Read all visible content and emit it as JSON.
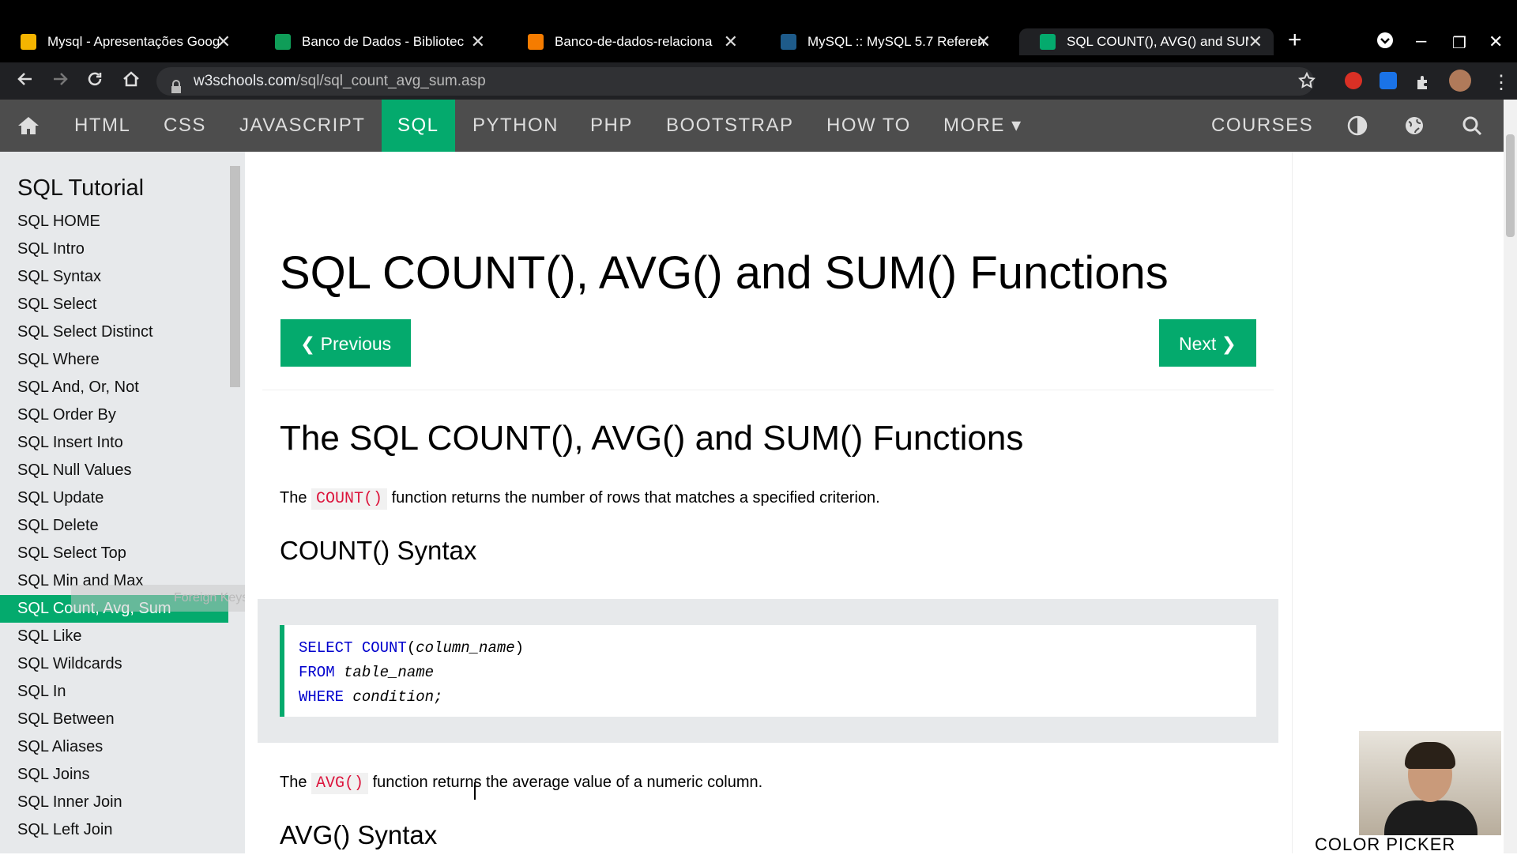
{
  "browser": {
    "tabs": [
      {
        "title": "Mysql - Apresentações Goog",
        "favicon_color": "#f4b400"
      },
      {
        "title": "Banco de Dados - Bibliotec",
        "favicon_color": "#0f9d58"
      },
      {
        "title": "Banco-de-dados-relaciona",
        "favicon_color": "#f57c00"
      },
      {
        "title": "MySQL :: MySQL 5.7 Referen",
        "favicon_color": "#1e5b8a"
      },
      {
        "title": "SQL COUNT(), AVG() and SUM",
        "favicon_color": "#04aa6d"
      }
    ],
    "url_domain": "w3schools.com",
    "url_path": "/sql/sql_count_avg_sum.asp",
    "new_tab_glyph": "+",
    "close_glyph": "✕"
  },
  "topnav": {
    "items": [
      "HTML",
      "CSS",
      "JAVASCRIPT",
      "SQL",
      "PYTHON",
      "PHP",
      "BOOTSTRAP",
      "HOW TO",
      "MORE ▾"
    ],
    "active": "SQL",
    "courses": "COURSES",
    "accent": "#04aa6d"
  },
  "sidebar": {
    "title": "SQL Tutorial",
    "items": [
      "SQL HOME",
      "SQL Intro",
      "SQL Syntax",
      "SQL Select",
      "SQL Select Distinct",
      "SQL Where",
      "SQL And, Or, Not",
      "SQL Order By",
      "SQL Insert Into",
      "SQL Null Values",
      "SQL Update",
      "SQL Delete",
      "SQL Select Top",
      "SQL Min and Max",
      "SQL Count, Avg, Sum",
      "SQL Like",
      "SQL Wildcards",
      "SQL In",
      "SQL Between",
      "SQL Aliases",
      "SQL Joins",
      "SQL Inner Join",
      "SQL Left Join"
    ],
    "active": "SQL Count, Avg, Sum",
    "drag_ghost": "Foreign Keys"
  },
  "main": {
    "title": "SQL COUNT(), AVG() and SUM() Functions",
    "prev": "❮ Previous",
    "next": "Next ❯",
    "section_title": "The SQL COUNT(), AVG() and SUM() Functions",
    "count_desc_pre": "The",
    "count_fn": "COUNT()",
    "count_desc_post": "function returns the number of rows that matches a specified criterion.",
    "count_syntax_heading": "COUNT() Syntax",
    "code_line1_kw": "SELECT COUNT",
    "code_line1_arg": "column_name",
    "code_line2_kw": "FROM",
    "code_line2_val": "table_name",
    "code_line3_kw": "WHERE",
    "code_line3_val": "condition;",
    "avg_desc_pre": "The",
    "avg_fn": "AVG()",
    "avg_desc_post": "function returns the average value of a numeric column.",
    "avg_syntax_heading": "AVG() Syntax"
  },
  "overlay": {
    "color_picker": "COLOR PICKER"
  }
}
